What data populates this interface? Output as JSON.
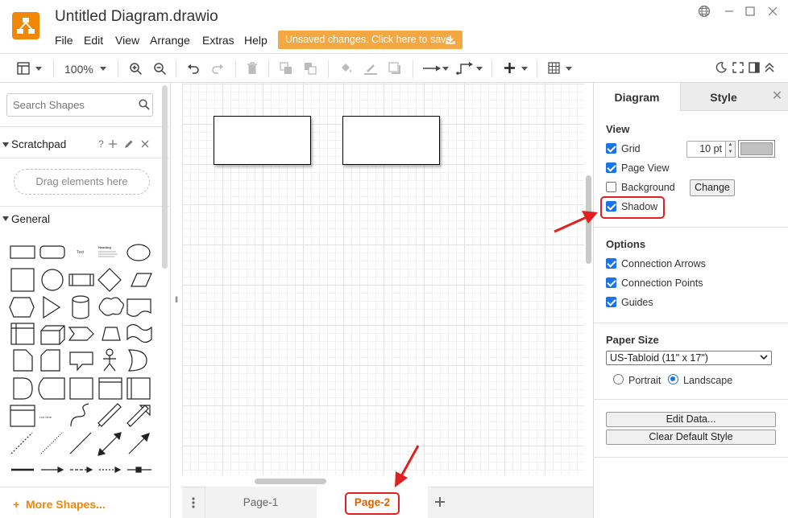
{
  "app": {
    "title": "Untitled Diagram.drawio",
    "menu": [
      "File",
      "Edit",
      "View",
      "Arrange",
      "Extras",
      "Help"
    ],
    "unsaved": "Unsaved changes. Click here to save.",
    "brand_color": "#f08705"
  },
  "toolbar": {
    "zoom": "100%"
  },
  "left_panel": {
    "search_placeholder": "Search Shapes",
    "scratchpad_title": "Scratchpad",
    "scratchpad_help": "?",
    "drag_hint": "Drag elements here",
    "general_title": "General",
    "more_shapes": "More Shapes...",
    "text_shape": "Text",
    "heading_shape": "Heading",
    "list_item_shape": "List Item"
  },
  "pages": {
    "tabs": [
      "Page-1",
      "Page-2"
    ],
    "active": "Page-2"
  },
  "right_panel": {
    "tabs": [
      "Diagram",
      "Style"
    ],
    "view": {
      "title": "View",
      "grid": {
        "label": "Grid",
        "checked": true,
        "size": "10 pt"
      },
      "page_view": {
        "label": "Page View",
        "checked": true
      },
      "background": {
        "label": "Background",
        "checked": false,
        "button": "Change"
      },
      "shadow": {
        "label": "Shadow",
        "checked": true
      }
    },
    "options": {
      "title": "Options",
      "items": [
        {
          "label": "Connection Arrows",
          "checked": true
        },
        {
          "label": "Connection Points",
          "checked": true
        },
        {
          "label": "Guides",
          "checked": true
        }
      ]
    },
    "paper": {
      "title": "Paper Size",
      "selected": "US-Tabloid (11\" x 17\")",
      "portrait": "Portrait",
      "landscape": "Landscape",
      "orientation": "landscape"
    },
    "buttons": {
      "edit_data": "Edit Data...",
      "clear_default_style": "Clear Default Style"
    }
  },
  "colors": {
    "accent": "#1a73e8",
    "highlight": "#e02020",
    "unsaved_bg": "#f5a742"
  }
}
